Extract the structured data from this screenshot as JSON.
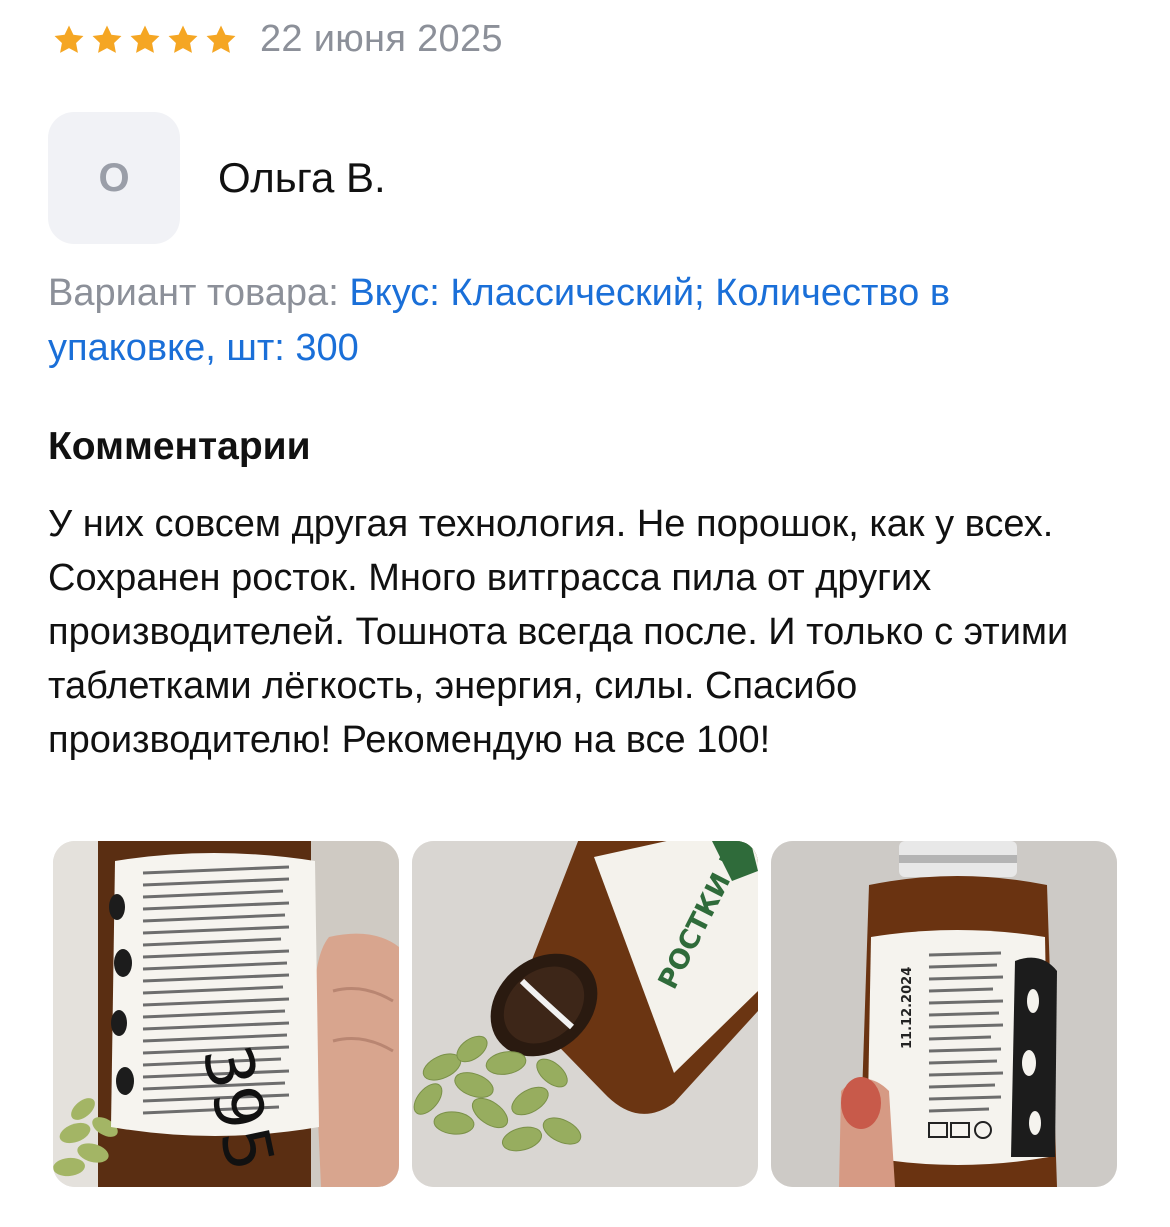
{
  "review": {
    "rating": 5,
    "rating_max": 5,
    "date": "22 июня 2025"
  },
  "author": {
    "initial": "О",
    "name": "Ольга В."
  },
  "variant": {
    "label": "Вариант товара:",
    "value": "Вкус: Классический; Количество в упаковке, шт: 300"
  },
  "comments": {
    "title": "Комментарии",
    "text": "У них совсем другая технология. Не порошок, как у всех. Сохранен росток. Много витграсса пила от других производителей. Тошнота всегда после. И только с этими таблетками лёгкость, энергия, силы. Спасибо производителю! Рекомендую на все 100!"
  },
  "photos": {
    "photo1": {
      "handwriting": "395"
    },
    "photo2": {
      "label_text": "РОСТКИ ПШЕНИЦЫ"
    },
    "photo3": {
      "date_text": "11.12.2024"
    }
  },
  "colors": {
    "star": "#f5a623",
    "link": "#1a6fd8",
    "muted": "#8c9099",
    "avatar_bg": "#f1f2f6"
  }
}
